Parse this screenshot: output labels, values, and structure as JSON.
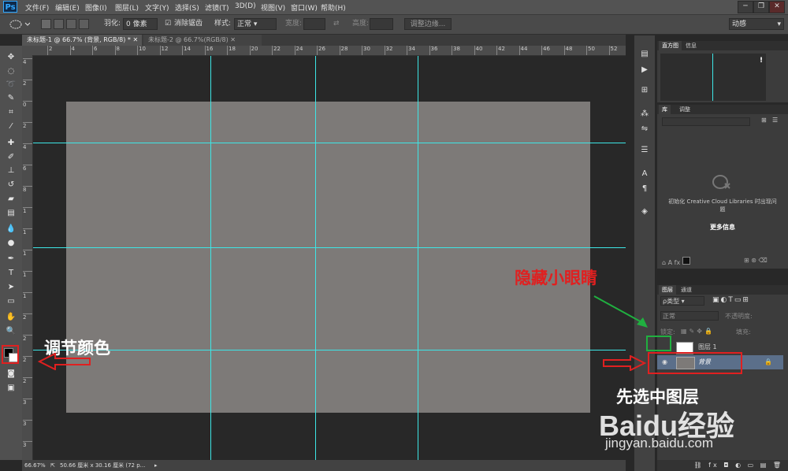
{
  "menubar": {
    "logo": "Ps",
    "items": [
      "文件(F)",
      "编辑(E)",
      "图像(I)",
      "图层(L)",
      "文字(Y)",
      "选择(S)",
      "滤镜(T)",
      "3D(D)",
      "视图(V)",
      "窗口(W)",
      "帮助(H)"
    ]
  },
  "optionsbar": {
    "feather_label": "羽化:",
    "feather_value": "0 像素",
    "antialias_label": "消除锯齿",
    "style_label": "样式:",
    "style_value": "正常",
    "width_label": "宽度:",
    "height_label": "高度:",
    "refine_button": "调整边缘...",
    "workspace": "动感"
  },
  "tabs": [
    {
      "label": "未标题-1 @ 66.7% (背景, RGB/8) *"
    },
    {
      "label": "未标题-2 @ 66.7%(RGB/8)"
    }
  ],
  "ruler_top": [
    "2",
    "4",
    "6",
    "8",
    "10",
    "12",
    "14",
    "16",
    "18",
    "20",
    "22",
    "24",
    "26",
    "28",
    "30",
    "32",
    "34",
    "36",
    "38",
    "40",
    "42",
    "44",
    "46",
    "48",
    "50",
    "52"
  ],
  "ruler_left": [
    "4",
    "2",
    "0",
    "2",
    "4",
    "6",
    "8",
    "1",
    "1",
    "1",
    "1",
    "1",
    "2",
    "2",
    "2",
    "2",
    "3",
    "3",
    "3"
  ],
  "statusbar": {
    "zoom": "66.67%",
    "size": "50.66 厘米 x 30.16 厘米 (72 p..."
  },
  "histogram_panel": {
    "tabs": [
      "直方图",
      "信息"
    ],
    "warning": "!"
  },
  "library_panel": {
    "tabs": [
      "库",
      "调整"
    ],
    "message": "初始化 Creative Cloud Libraries 时出现问题",
    "more_link": "更多信息"
  },
  "layers_panel": {
    "tabs": [
      "图层",
      "通道"
    ],
    "filter_kind": "ρ类型",
    "blend_mode": "正常",
    "opacity_label": "不透明度:",
    "lock_label": "锁定:",
    "fill_label": "填充:",
    "layers": [
      {
        "name": "图层 1",
        "selected": false
      },
      {
        "name": "背景",
        "selected": true
      }
    ]
  },
  "annotations": {
    "adjust_color": "调节颜色",
    "hide_eye": "隐藏小眼睛",
    "select_layer": "先选中图层"
  },
  "watermark": {
    "brand": "Baidu经验",
    "url": "jingyan.baidu.com"
  },
  "colors": {
    "guide": "#3de6e6",
    "canvas": "#7d7a78",
    "accent_red": "#e02020",
    "accent_green": "#20b040"
  }
}
